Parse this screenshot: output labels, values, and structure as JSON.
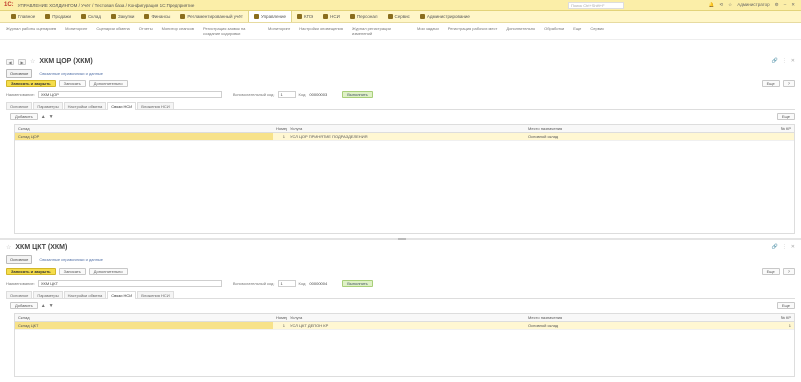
{
  "titlebar": {
    "logo": "1С:",
    "title": "УПРАВЛЕНИЕ ХОЛДИНГОМ / Учёт / Тестовая база / Конфигурация 1С:Предприятие",
    "search_placeholder": "Поиск Ctrl+Shift+F",
    "user": "Администратор",
    "icons": [
      "bell-icon",
      "history-icon",
      "star-icon",
      "settings-icon",
      "minimize-icon",
      "close-icon"
    ]
  },
  "sections": [
    {
      "label": "Главное",
      "icon": "home-icon"
    },
    {
      "label": "Продажи",
      "icon": "cart-icon"
    },
    {
      "label": "Склад",
      "icon": "box-icon"
    },
    {
      "label": "Закупки",
      "icon": "truck-icon"
    },
    {
      "label": "Финансы",
      "icon": "coin-icon"
    },
    {
      "label": "Регламентированный учёт",
      "icon": "book-icon"
    },
    {
      "label": "Управление",
      "icon": "chart-icon",
      "active": true
    },
    {
      "label": "КПЭ",
      "icon": "target-icon"
    },
    {
      "label": "НСИ",
      "icon": "list-icon"
    },
    {
      "label": "Персонал",
      "icon": "people-icon"
    },
    {
      "label": "Сервис",
      "icon": "wrench-icon"
    },
    {
      "label": "Администрирование",
      "icon": "gear-icon"
    }
  ],
  "functions": [
    "Журнал работы сценариев",
    "Мониторинг",
    "Сценарии обмена",
    "Отчеты",
    "Монитор сеансов",
    "Регистрация заявок на создание кодировки",
    "Мониторинг",
    "Настройки оповещения",
    "Журнал регистрации изменений",
    "Мои задачи",
    "Регистрация рабочих мест",
    "Дополнительно",
    "Обработки",
    "Еще",
    "Сервис"
  ],
  "panel1": {
    "title": "ХКМ ЦОР (ХКМ)",
    "subtabs": [
      "Основное",
      "Связанные справочники и данные"
    ],
    "commands": {
      "save_close": "Записать и закрыть",
      "save": "Записать",
      "more": "Дополнительно",
      "right_more": "Еще",
      "help": "?"
    },
    "name_label": "Наименование:",
    "name_value": "ХКМ ЦОР",
    "field2_label": "Вспомогательный код:",
    "field2_value": "1",
    "code_label": "Код:",
    "code_value": "00000003",
    "green_button": "Выполнить",
    "tabs": [
      "Основное",
      "Параметры",
      "Настройки обмена",
      "Связи НСИ",
      "Вложения НСИ"
    ],
    "active_tab": 3,
    "table_buttons": {
      "add": "Добавить",
      "up": "▲",
      "down": "▼",
      "more": "Еще"
    },
    "columns": [
      "Склад",
      "Номер",
      "Услуга",
      "Место назначения",
      "№ КР"
    ],
    "rows": [
      {
        "col1": "Склад ЦОР",
        "col2": "1",
        "col3": "УСЛ ЦОР ПРИНЯТИЕ ПОДРАЗДЕЛЕНИЯ",
        "col4": "Основной склад",
        "col5": ""
      }
    ]
  },
  "panel2": {
    "title": "ХКМ ЦКТ (ХКМ)",
    "subtabs": [
      "Основное",
      "Связанные справочники и данные"
    ],
    "commands": {
      "save_close": "Записать и закрыть",
      "save": "Записать",
      "more": "Дополнительно",
      "right_more": "Еще",
      "help": "?"
    },
    "name_label": "Наименование:",
    "name_value": "ХКМ ЦКТ",
    "field2_label": "Вспомогательный код:",
    "field2_value": "1",
    "code_label": "Код:",
    "code_value": "00000004",
    "green_button": "Выполнить",
    "tabs": [
      "Основное",
      "Параметры",
      "Настройки обмена",
      "Связи НСИ",
      "Вложения НСИ"
    ],
    "active_tab": 3,
    "table_buttons": {
      "add": "Добавить",
      "up": "▲",
      "down": "▼",
      "more": "Еще"
    },
    "columns": [
      "Склад",
      "Номер",
      "Услуга",
      "Место назначения",
      "№ КР"
    ],
    "rows": [
      {
        "col1": "Склад ЦКТ",
        "col2": "1",
        "col3": "УСЛ ЦКТ ДЕПОН КР",
        "col4": "Основной склад",
        "col5": "1"
      }
    ]
  }
}
